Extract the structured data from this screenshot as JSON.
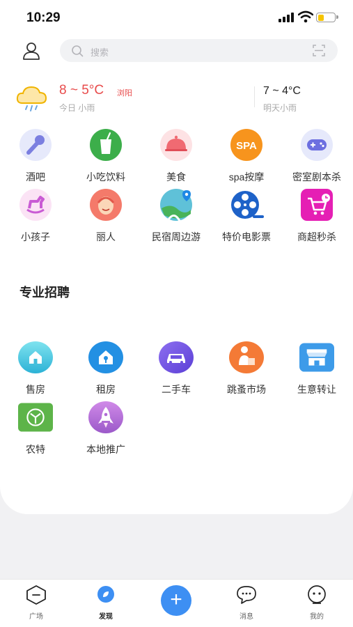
{
  "status": {
    "time": "10:29"
  },
  "search": {
    "placeholder": "搜索"
  },
  "weather": {
    "today_temp": "8 ~ 5°C",
    "city": "浏阳",
    "today_desc": "今日 小雨",
    "tomorrow_temp": "7 ~ 4°C",
    "tomorrow_desc": "明天小雨"
  },
  "categories": [
    {
      "label": "酒吧",
      "icon": "microphone-icon"
    },
    {
      "label": "小吃饮料",
      "icon": "drink-cup-icon"
    },
    {
      "label": "美食",
      "icon": "food-cloche-icon"
    },
    {
      "label": "spa按摩",
      "icon": "spa-icon",
      "badge": "SPA"
    },
    {
      "label": "密室剧本杀",
      "icon": "gamepad-icon"
    },
    {
      "label": "小孩子",
      "icon": "rocking-horse-icon"
    },
    {
      "label": "丽人",
      "icon": "beauty-face-icon"
    },
    {
      "label": "民宿周边游",
      "icon": "travel-map-icon"
    },
    {
      "label": "特价电影票",
      "icon": "film-reel-icon"
    },
    {
      "label": "商超秒杀",
      "icon": "shopping-cart-icon"
    }
  ],
  "section": {
    "title": "专业招聘"
  },
  "services": [
    {
      "label": "售房",
      "icon": "house-sale-icon"
    },
    {
      "label": "租房",
      "icon": "house-rent-icon"
    },
    {
      "label": "二手车",
      "icon": "car-icon"
    },
    {
      "label": "跳蚤市场",
      "icon": "flea-market-icon"
    },
    {
      "label": "生意转让",
      "icon": "shop-transfer-icon"
    },
    {
      "label": "农特",
      "icon": "farm-produce-icon"
    },
    {
      "label": "本地推广",
      "icon": "rocket-icon"
    }
  ],
  "tabs": [
    {
      "label": "广场",
      "icon": "hexagon-minus-icon"
    },
    {
      "label": "发现",
      "icon": "discover-icon"
    },
    {
      "label": "",
      "icon": "plus-icon"
    },
    {
      "label": "消息",
      "icon": "message-bubble-icon"
    },
    {
      "label": "我的",
      "icon": "profile-face-icon"
    }
  ],
  "colors": {
    "accent": "#3d8ff3",
    "temp": "#e84b4b"
  }
}
